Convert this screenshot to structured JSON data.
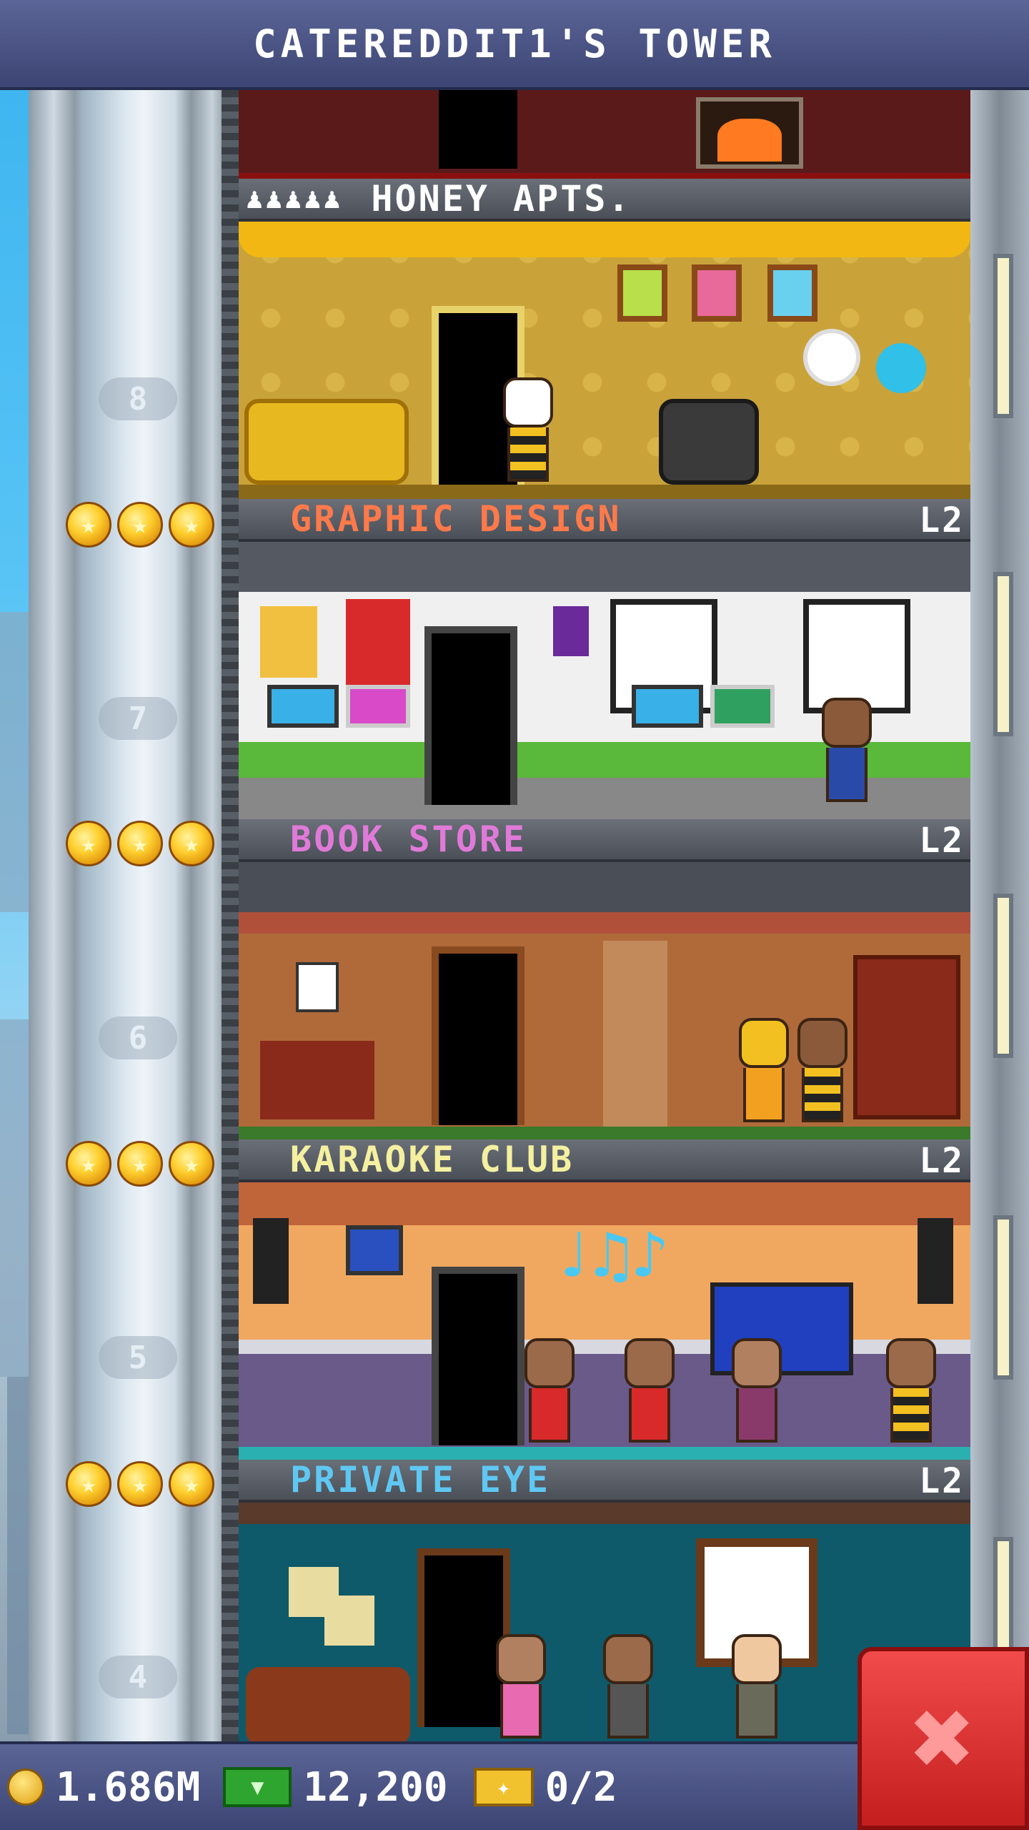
{
  "header": {
    "title": "CATEREDDIT1'S TOWER"
  },
  "colors": {
    "graphic_design": "#ff7a4a",
    "book_store": "#e07ad8",
    "karaoke_club": "#f4f0a0",
    "private_eye": "#5fc8f2",
    "honey_apts": "#ffffff"
  },
  "floors": [
    {
      "number": "8",
      "name": "HONEY APTS.",
      "type": "residential",
      "residents": "♟♟♟♟♟",
      "level": ""
    },
    {
      "number": "7",
      "name": "GRAPHIC DESIGN",
      "level": "L2",
      "stars": 3
    },
    {
      "number": "6",
      "name": "BOOK STORE",
      "level": "L2",
      "stars": 3
    },
    {
      "number": "5",
      "name": "KARAOKE CLUB",
      "level": "L2",
      "stars": 3
    },
    {
      "number": "4",
      "name": "PRIVATE EYE",
      "level": "L2",
      "stars": 3
    }
  ],
  "footer": {
    "coins": "1.686M",
    "bux": "12,200",
    "tickets": "0/2"
  },
  "icons": {
    "star": "star-icon",
    "coin": "coin-icon",
    "bux": "bux-icon",
    "ticket": "ticket-icon",
    "close": "close-icon"
  }
}
